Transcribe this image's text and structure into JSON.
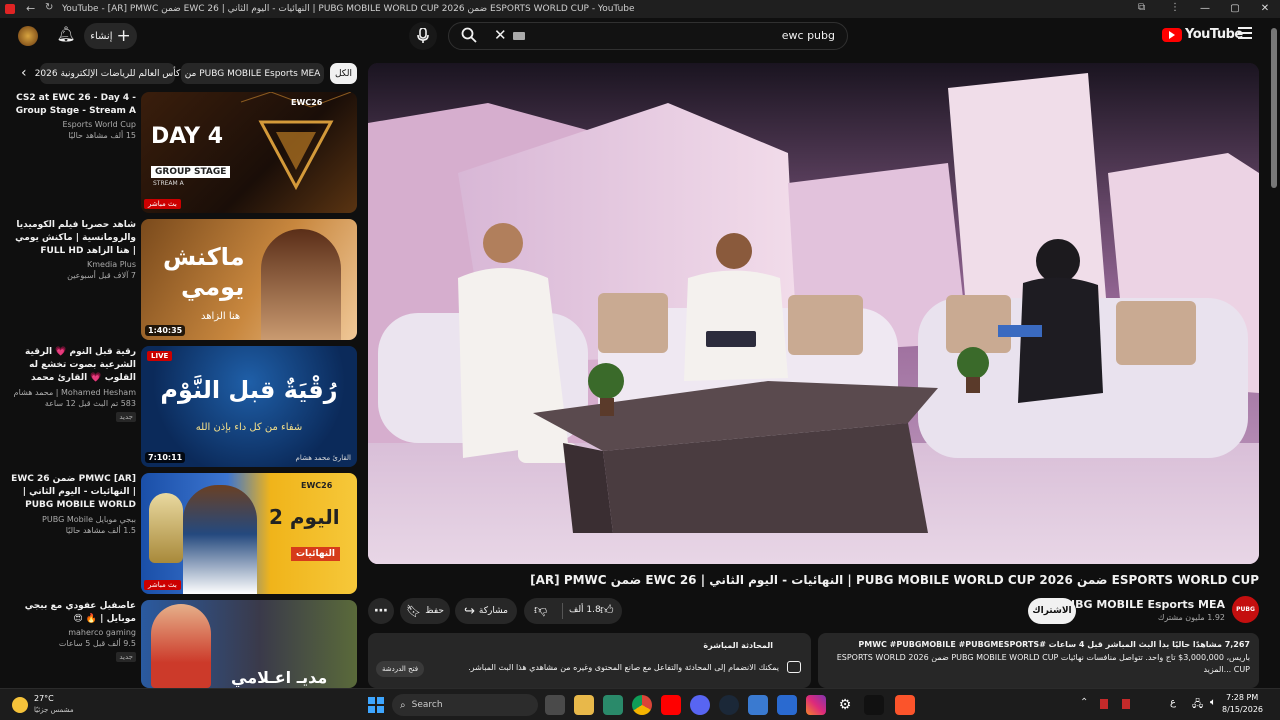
{
  "window": {
    "title": "YouTube - [AR] PMWC ضمن EWC 26 | النهائيات - اليوم الثاني | PUBG MOBILE WORLD CUP 2026 ضمن ESPORTS WORLD CUP - YouTube"
  },
  "header": {
    "create_label": "إنشاء",
    "search_value": "ewc pubg",
    "logo_text": "YouTube"
  },
  "chips": {
    "all": "الكل",
    "from_channel": "من PUBG MOBILE Esports MEA",
    "ewc": "كأس العالم للرياضات الإلكترونية 2026"
  },
  "related": [
    {
      "title": "CS2 at EWC 26 - Day 4 - Group Stage - Stream A",
      "channel": "Esports World Cup",
      "stats": "15 ألف مشاهد حاليًا",
      "overlay": "بث مباشر",
      "thumb_text1": "DAY 4",
      "thumb_text2": "GROUP STAGE",
      "thumb_text3": "STREAM A",
      "thumb_logo": "EWC26"
    },
    {
      "title": "شاهد حصريا فيلم الكوميديا والرومانسية | ماكنش يومي | هنا الزاهد FULL HD",
      "channel": "Kmedia Plus",
      "stats": "7 آلاف  قبل أسبوعين",
      "duration": "1:40:35",
      "thumb_text1": "ماكنش",
      "thumb_text2": "يومي",
      "thumb_text3": "هنا الزاهد"
    },
    {
      "title": "رقية قبل النوم 💗 الرقية الشرعية بصوت تخشع له القلوب 💗 القارئ محمد هشام Ruqiah Al-Nawm 💗",
      "channel": "Mohamed Hesham | محمد هشام",
      "stats": "583  تم البث قبل 12 ساعة",
      "badge": "جديد",
      "duration": "7:10:11",
      "live": "LIVE",
      "thumb_text1": "رُقْيَةٌ قبل النَّوْم",
      "thumb_text2": "شفاء من كل داء بإذن الله",
      "thumb_text3": "القارئ محمد هشام"
    },
    {
      "title": "[AR] PMWC ضمن EWC 26 | النهائيات - اليوم الثاني | PUBG MOBILE WORLD CUP ضمن ...",
      "channel": "ببجي موبايل PUBG Mobile",
      "stats": "1.5 ألف مشاهد حاليًا",
      "overlay": "بث مباشر",
      "thumb_text1": "اليوم 2",
      "thumb_text2": "النهائيات",
      "thumb_logo": "EWC26"
    },
    {
      "title": "عاصفيل عفودي مع ببجي موبايل | 🔥 😍",
      "channel": "maherco gaming",
      "stats": "9.5 ألف  قبل 5 ساعات",
      "badge": "جديد",
      "thumb_text1": "مديـ اعـلامي"
    }
  ],
  "video": {
    "title": "[AR] PMWC ضمن EWC 26 | النهائيات - اليوم الثاني | PUBG MOBILE WORLD CUP 2026 ضمن ESPORTS WORLD CUP",
    "channel_name": "PUBG MOBILE Esports MEA",
    "subscribers": "1.92 مليون مشترك",
    "subscribe_label": "الاشتراك",
    "likes": "1.8 ألف",
    "share_label": "مشاركة",
    "save_label": "حفظ"
  },
  "description": {
    "stats": "7,267 مشاهدًا حاليًا  بدأ البث المباشر قبل 4 ساعات  #PMWC #PUBGMOBILE #PUBGMESPORTS",
    "line2": "باريس، 3,000,000$ تاج واحد. تتواصل منافسات نهائيات PUBG MOBILE WORLD CUP ضمن ESPORTS WORLD 2026",
    "line3": "CUP ...المزيد"
  },
  "chat": {
    "title": "المحادثة المباشرة",
    "body": "يمكنك الانضمام إلى المحادثة والتفاعل مع صانع المحتوى وغيره من مشاهدي هذا البث المباشر.",
    "open_label": "فتح الدردشة"
  },
  "taskbar": {
    "weather_temp": "27°C",
    "weather_desc": "مشمس جزئيًا",
    "search_label": "Search",
    "lang": "ع",
    "time": "7:28 PM",
    "date": "8/15/2026"
  },
  "colors": {
    "bg": "#0f0f0f",
    "surface": "#272727",
    "brand_red": "#ff0000",
    "text": "#f1f1f1",
    "muted": "#aaaaaa"
  }
}
